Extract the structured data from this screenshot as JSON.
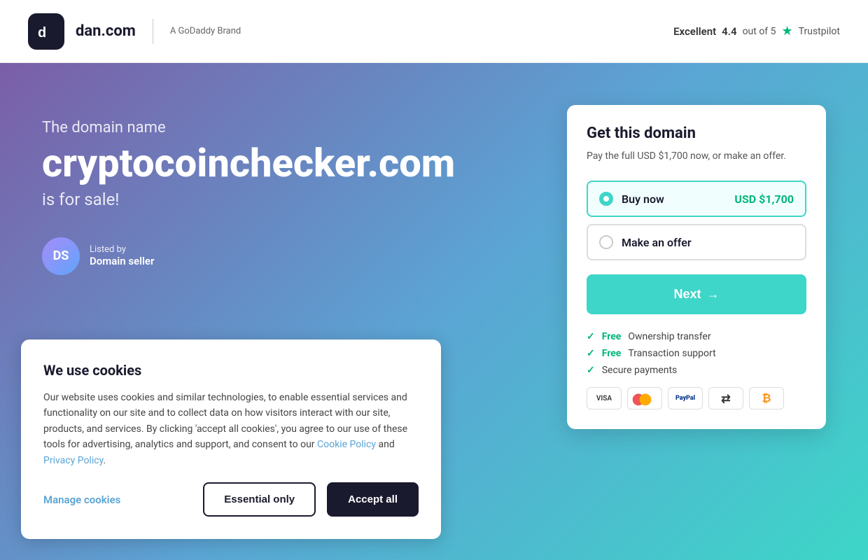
{
  "header": {
    "logo_text": "dan.com",
    "logo_icon_text": "d",
    "godaddy_text": "A GoDaddy Brand",
    "trustpilot": {
      "label": "Excellent",
      "score": "4.4",
      "out_of": "out of 5",
      "brand": "Trustpilot"
    }
  },
  "hero": {
    "subtitle": "The domain name",
    "domain": "cryptocoinchecker.com",
    "sale_text": "is for sale!",
    "seller": {
      "initials": "DS",
      "listed_by": "Listed by",
      "name": "Domain seller"
    }
  },
  "card": {
    "title": "Get this domain",
    "subtitle": "Pay the full USD $1,700 now, or make an offer.",
    "options": [
      {
        "label": "Buy now",
        "price": "USD $1,700",
        "selected": true
      },
      {
        "label": "Make an offer",
        "price": "",
        "selected": false
      }
    ],
    "next_button": "Next",
    "next_arrow": "→",
    "benefits": [
      {
        "free": true,
        "text": "Ownership transfer"
      },
      {
        "free": true,
        "text": "Transaction support"
      },
      {
        "free": false,
        "text": "Secure payments"
      }
    ],
    "payment_icons": [
      "VISA",
      "●●",
      "PayPal",
      "⇄",
      "₿"
    ]
  },
  "cookie_banner": {
    "title": "We use cookies",
    "body": "Our website uses cookies and similar technologies, to enable essential services and functionality on our site and to collect data on how visitors interact with our site, products, and services. By clicking 'accept all cookies', you agree to our use of these tools for advertising, analytics and support, and consent to our",
    "cookie_policy_link": "Cookie Policy",
    "and_text": "and",
    "privacy_policy_link": "Privacy Policy",
    "period": ".",
    "manage_label": "Manage cookies",
    "essential_label": "Essential only",
    "accept_label": "Accept all"
  }
}
